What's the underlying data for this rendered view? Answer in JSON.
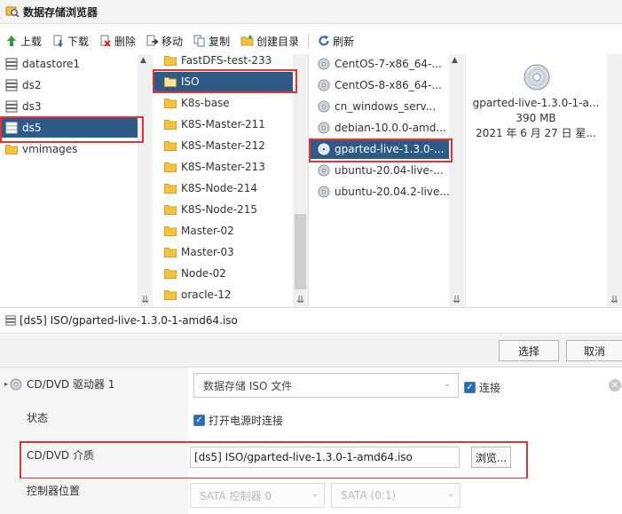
{
  "window": {
    "title": "数据存储浏览器"
  },
  "toolbar": {
    "upload": "上载",
    "download": "下载",
    "delete": "删除",
    "move": "移动",
    "copy": "复制",
    "mkdir": "创建目录",
    "refresh": "刷新"
  },
  "datastores": [
    "datastore1",
    "ds2",
    "ds3",
    "ds5",
    "vmimages"
  ],
  "folders": [
    "FastDFS-test-233",
    "ISO",
    "K8s-base",
    "K8S-Master-211",
    "K8S-Master-212",
    "K8S-Master-213",
    "K8S-Node-214",
    "K8S-Node-215",
    "Master-02",
    "Master-03",
    "Node-02",
    "oracle-12"
  ],
  "files": [
    "CentOS-7-x86_64-...",
    "CentOS-8-x86_64-...",
    "cn_windows_serv...",
    "debian-10.0.0-amd...",
    "gparted-live-1.3.0-...",
    "ubuntu-20.04-live-...",
    "ubuntu-20.04.2-live..."
  ],
  "preview": {
    "name": "gparted-live-1.3.0-1-a...",
    "size": "390 MB",
    "date": "2021 年 6 月 27 日 星..."
  },
  "path": "[ds5] ISO/gparted-live-1.3.0-1-amd64.iso",
  "buttons": {
    "select": "选择",
    "cancel": "取消"
  },
  "form": {
    "cd_label": "CD/DVD 驱动器 1",
    "cd_type": "数据存储 ISO 文件",
    "connect": "连接",
    "status_label": "状态",
    "poweron": "打开电源时连接",
    "media_label": "CD/DVD 介质",
    "media_value": "[ds5] ISO/gparted-live-1.3.0-1-amd64.iso",
    "browse": "浏览...",
    "controller_label": "控制器位置",
    "controller": "SATA 控制器 0",
    "slot": "SATA (0:1)"
  },
  "colors": {
    "selection": "#2f5a86",
    "highlight": "#e03535",
    "folder": "#f5c242"
  }
}
